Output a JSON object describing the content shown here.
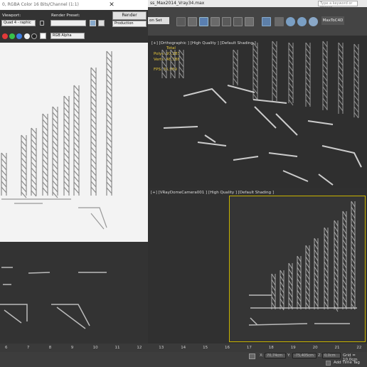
{
  "app": {
    "title": "ss_Max2014_Vray34.max",
    "search_placeholder": "Type a keyword or phrase",
    "selection_set": "on Set",
    "plugin_button": "MaxToC4D"
  },
  "render_frame": {
    "title": "0, RGBA Color 16 Bits/Channel (1:1)",
    "viewport_label": "Viewport:",
    "viewport_value": "Quad 4 - raphic",
    "preset_label": "Render Preset:",
    "preset_value": "",
    "render_button": "Render",
    "mode_value": "Production",
    "channel_value": "RGB Alpha",
    "close": "✕"
  },
  "viewports": {
    "top": {
      "label": "[+] [Orthographic ] [High Quality ] [Default Shading ]",
      "stats_total": "Total",
      "polys_label": "Polys:",
      "polys_value": "97,283",
      "verts_label": "Verts:",
      "verts_value": "48,188",
      "fps_label": "FPS:",
      "fps_value": "35,989"
    },
    "camera": {
      "label": "[+] [VRayDomeCamera001 ] [High Quality ] [Default Shading ]"
    }
  },
  "timeline": {
    "ticks": [
      "6",
      "7",
      "8",
      "9",
      "10",
      "11",
      "12",
      "13",
      "14",
      "15",
      "16",
      "17",
      "18",
      "19",
      "20",
      "21",
      "22"
    ]
  },
  "status": {
    "x_label": "X:",
    "x_value": "70,74cm",
    "y_label": "Y:",
    "y_value": "-75,405cm",
    "z_label": "Z:",
    "z_value": "0,0cm",
    "grid": "Grid = 10,0cm",
    "add_time_tag": "Add Time Tag"
  },
  "colors": {
    "viewport_bg": "#2f2f2f",
    "render_bg": "#f3f3f3",
    "stats_yellow": "#e8c83a",
    "active_border": "#c8b400"
  }
}
